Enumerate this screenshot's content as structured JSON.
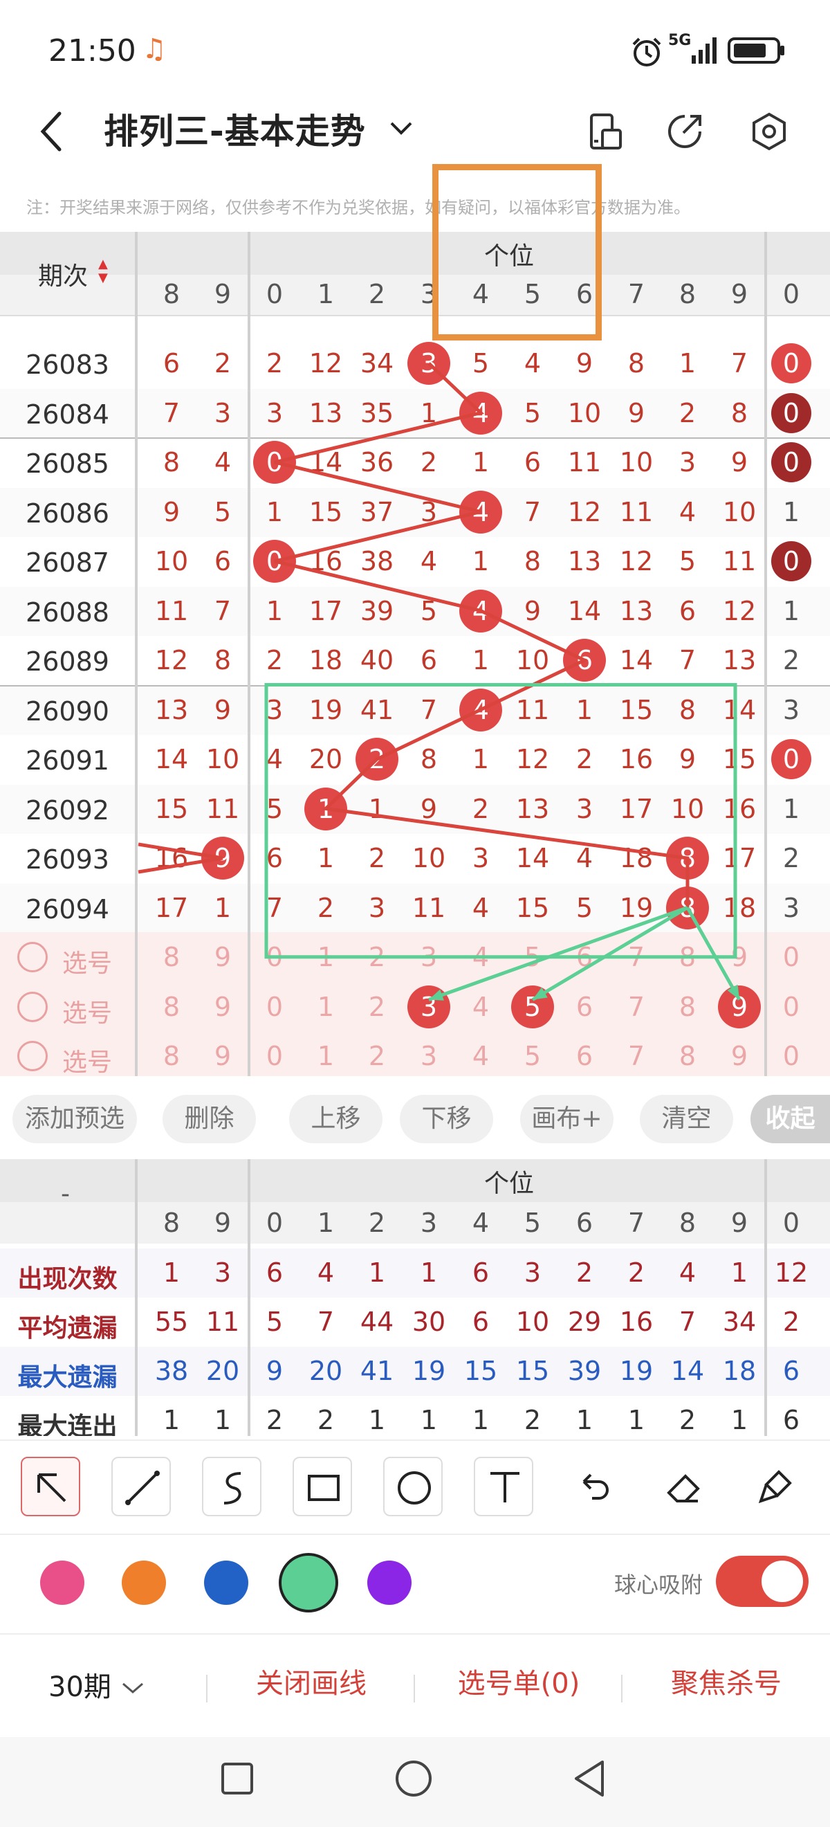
{
  "status": {
    "time": "21:50",
    "network": "5G"
  },
  "header": {
    "title": "排列三-基本走势"
  },
  "note": "注：开奖结果来源于网络，仅供参考不作为兑奖依据，如有疑问，以福体彩官方数据为准。",
  "table": {
    "period_header": "期次",
    "section_label": "个位",
    "col_headers": [
      "8",
      "9",
      "0",
      "1",
      "2",
      "3",
      "4",
      "5",
      "6",
      "7",
      "8",
      "9",
      "0"
    ],
    "rows": [
      {
        "period": "26083",
        "cells": [
          "6",
          "2",
          "2",
          "12",
          "34",
          "3",
          "5",
          "4",
          "9",
          "8",
          "1",
          "7",
          "0"
        ],
        "hit": 5,
        "last": "0",
        "last_style": "ball"
      },
      {
        "period": "26084",
        "cells": [
          "7",
          "3",
          "3",
          "13",
          "35",
          "1",
          "4",
          "5",
          "10",
          "9",
          "2",
          "8",
          "0"
        ],
        "hit": 6,
        "last": "0",
        "last_style": "dark"
      },
      {
        "period": "26085",
        "cells": [
          "8",
          "4",
          "0",
          "14",
          "36",
          "2",
          "1",
          "6",
          "11",
          "10",
          "3",
          "9",
          "0"
        ],
        "hit": 2,
        "last": "0",
        "last_style": "dark"
      },
      {
        "period": "26086",
        "cells": [
          "9",
          "5",
          "1",
          "15",
          "37",
          "3",
          "4",
          "7",
          "12",
          "11",
          "4",
          "10",
          "1"
        ],
        "hit": 6,
        "last": "1",
        "last_style": "plain"
      },
      {
        "period": "26087",
        "cells": [
          "10",
          "6",
          "0",
          "16",
          "38",
          "4",
          "1",
          "8",
          "13",
          "12",
          "5",
          "11",
          "0"
        ],
        "hit": 2,
        "last": "0",
        "last_style": "dark"
      },
      {
        "period": "26088",
        "cells": [
          "11",
          "7",
          "1",
          "17",
          "39",
          "5",
          "4",
          "9",
          "14",
          "13",
          "6",
          "12",
          "1"
        ],
        "hit": 6,
        "last": "1",
        "last_style": "plain"
      },
      {
        "period": "26089",
        "cells": [
          "12",
          "8",
          "2",
          "18",
          "40",
          "6",
          "1",
          "10",
          "6",
          "14",
          "7",
          "13",
          "2"
        ],
        "hit": 8,
        "last": "2",
        "last_style": "plain"
      },
      {
        "period": "26090",
        "cells": [
          "13",
          "9",
          "3",
          "19",
          "41",
          "7",
          "4",
          "11",
          "1",
          "15",
          "8",
          "14",
          "3"
        ],
        "hit": 6,
        "last": "3",
        "last_style": "plain"
      },
      {
        "period": "26091",
        "cells": [
          "14",
          "10",
          "4",
          "20",
          "2",
          "8",
          "1",
          "12",
          "2",
          "16",
          "9",
          "15",
          "0"
        ],
        "hit": 4,
        "last": "0",
        "last_style": "ball"
      },
      {
        "period": "26092",
        "cells": [
          "15",
          "11",
          "5",
          "1",
          "1",
          "9",
          "2",
          "13",
          "3",
          "17",
          "10",
          "16",
          "1"
        ],
        "hit": 3,
        "last": "1",
        "last_style": "plain"
      },
      {
        "period": "26093",
        "cells": [
          "16",
          "9",
          "6",
          "1",
          "2",
          "10",
          "3",
          "14",
          "4",
          "18",
          "8",
          "17",
          "2"
        ],
        "hit": 10,
        "last": "2",
        "last_style": "plain",
        "extra_hit": 1
      },
      {
        "period": "26094",
        "cells": [
          "17",
          "1",
          "7",
          "2",
          "3",
          "11",
          "4",
          "15",
          "5",
          "19",
          "8",
          "18",
          "3"
        ],
        "hit": 10,
        "last": "3",
        "last_style": "plain"
      }
    ],
    "select_rows": [
      {
        "label": "选号",
        "cells": [
          "8",
          "9",
          "0",
          "1",
          "2",
          "3",
          "4",
          "5",
          "6",
          "7",
          "8",
          "9",
          "0"
        ],
        "balls": []
      },
      {
        "label": "选号",
        "cells": [
          "8",
          "9",
          "0",
          "1",
          "2",
          "3",
          "4",
          "5",
          "6",
          "7",
          "8",
          "9",
          "0"
        ],
        "balls": [
          5,
          7,
          11
        ]
      },
      {
        "label": "选号",
        "cells": [
          "8",
          "9",
          "0",
          "1",
          "2",
          "3",
          "4",
          "5",
          "6",
          "7",
          "8",
          "9",
          "0"
        ],
        "balls": []
      }
    ]
  },
  "actions": [
    "添加预选",
    "删除",
    "上移",
    "下移",
    "画布+",
    "清空",
    "收起"
  ],
  "stats": {
    "dash": "-",
    "section_label": "个位",
    "col_headers": [
      "8",
      "9",
      "0",
      "1",
      "2",
      "3",
      "4",
      "5",
      "6",
      "7",
      "8",
      "9",
      "0"
    ],
    "rows": [
      {
        "label": "出现次数",
        "color": "#a8262b",
        "values": [
          "1",
          "3",
          "6",
          "4",
          "1",
          "1",
          "6",
          "3",
          "2",
          "2",
          "4",
          "1",
          "12"
        ],
        "value_color": "#a8262b"
      },
      {
        "label": "平均遗漏",
        "color": "#a8262b",
        "values": [
          "55",
          "11",
          "5",
          "7",
          "44",
          "30",
          "6",
          "10",
          "29",
          "16",
          "7",
          "34",
          "2"
        ],
        "value_color": "#a8262b"
      },
      {
        "label": "最大遗漏",
        "color": "#2a5cc0",
        "values": [
          "38",
          "20",
          "9",
          "20",
          "41",
          "19",
          "15",
          "15",
          "39",
          "19",
          "14",
          "18",
          "6"
        ],
        "value_color": "#2a5cc0"
      },
      {
        "label": "最大连出",
        "color": "#333333",
        "values": [
          "1",
          "1",
          "2",
          "2",
          "1",
          "1",
          "1",
          "2",
          "1",
          "1",
          "2",
          "1",
          "6"
        ],
        "value_color": "#333333"
      }
    ]
  },
  "tools": [
    "arrow-icon",
    "line-icon",
    "curve-icon",
    "rect-icon",
    "circle-icon",
    "text-icon",
    "undo-icon",
    "eraser-icon",
    "brush-icon"
  ],
  "colors": [
    "#e9508a",
    "#ef7f2a",
    "#2262c6",
    "#5bcf94",
    "#8c26e6"
  ],
  "snap_label": "球心吸附",
  "bottom": {
    "period": "30期",
    "close_line": "关闭画线",
    "pick_list": "选号单(0)",
    "focus_kill": "聚焦杀号"
  }
}
